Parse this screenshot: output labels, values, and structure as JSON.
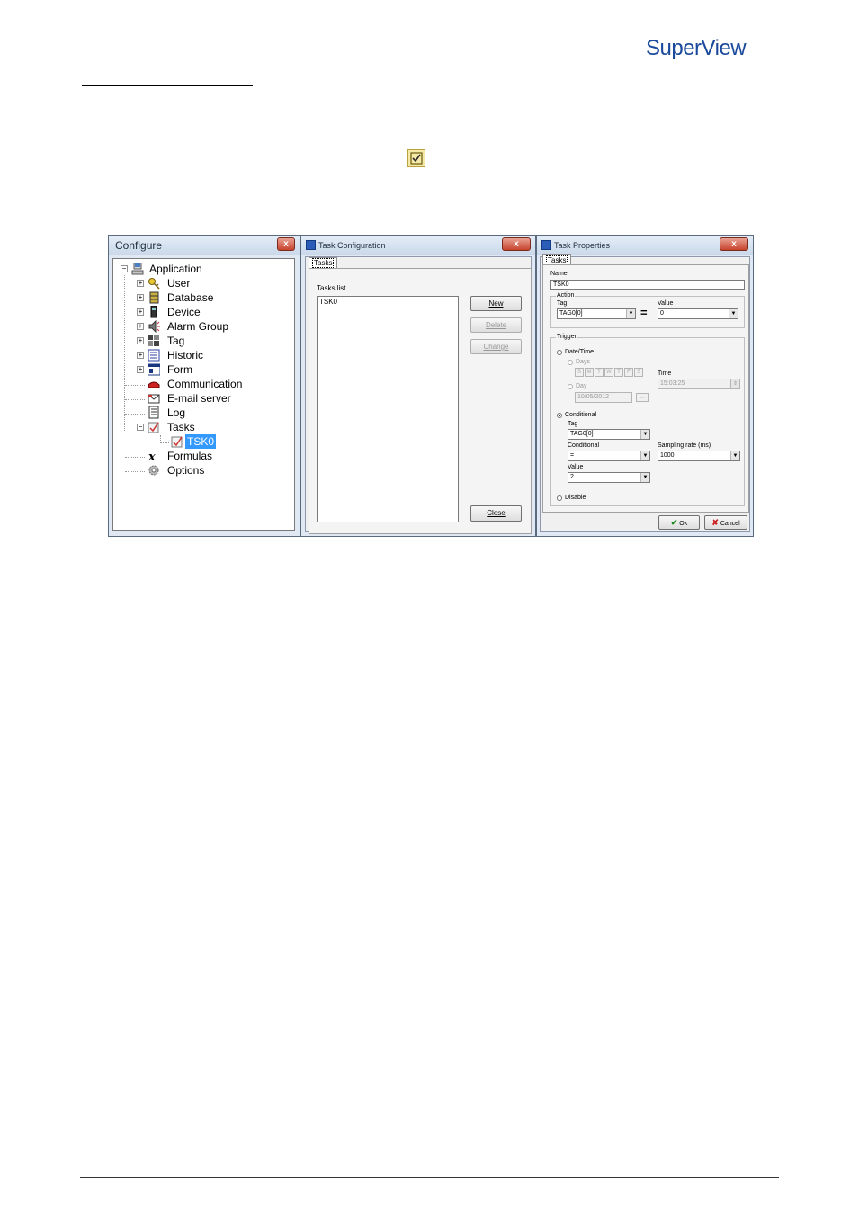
{
  "header": {
    "logo_super": "Super",
    "logo_view": "View"
  },
  "configure_window": {
    "title": "Configure",
    "close": "x",
    "tree": [
      {
        "label": "Application"
      },
      {
        "label": "User"
      },
      {
        "label": "Database"
      },
      {
        "label": "Device"
      },
      {
        "label": "Alarm Group"
      },
      {
        "label": "Tag"
      },
      {
        "label": "Historic"
      },
      {
        "label": "Form"
      },
      {
        "label": "Communication"
      },
      {
        "label": "E-mail server"
      },
      {
        "label": "Log"
      },
      {
        "label": "Tasks"
      },
      {
        "label": "TSK0"
      },
      {
        "label": "Formulas"
      },
      {
        "label": "Options"
      }
    ]
  },
  "task_config_window": {
    "title": "Task Configuration",
    "close": "x",
    "tab": "Tasks",
    "list_label": "Tasks list",
    "list_items": [
      "TSK0"
    ],
    "buttons": {
      "new": "New",
      "delete": "Delete",
      "change": "Change",
      "close": "Close"
    }
  },
  "task_props_window": {
    "title": "Task Properties",
    "close": "x",
    "tab": "Tasks",
    "name_label": "Name",
    "name_value": "TSK0",
    "action": {
      "group": "Action",
      "tag_label": "Tag",
      "tag_value": "TAG0[0]",
      "equals": "=",
      "value_label": "Value",
      "value_value": "0"
    },
    "trigger": {
      "group": "Trigger",
      "datetime_label": "Date/Time",
      "days_label": "Days",
      "days": [
        "S",
        "M",
        "T",
        "W",
        "T",
        "F",
        "S"
      ],
      "time_label": "Time",
      "time_value": "15:03:25",
      "day_label": "Day",
      "day_value": "10/05/2012",
      "conditional_label": "Conditional",
      "tag_label": "Tag",
      "tag_value": "TAG0[0]",
      "cond_label": "Conditional",
      "cond_value": "=",
      "sampling_label": "Sampling rate (ms)",
      "sampling_value": "1000",
      "value_label": "Value",
      "value_value": "2",
      "disable_label": "Disable"
    },
    "buttons": {
      "ok": "Ok",
      "cancel": "Cancel"
    }
  }
}
